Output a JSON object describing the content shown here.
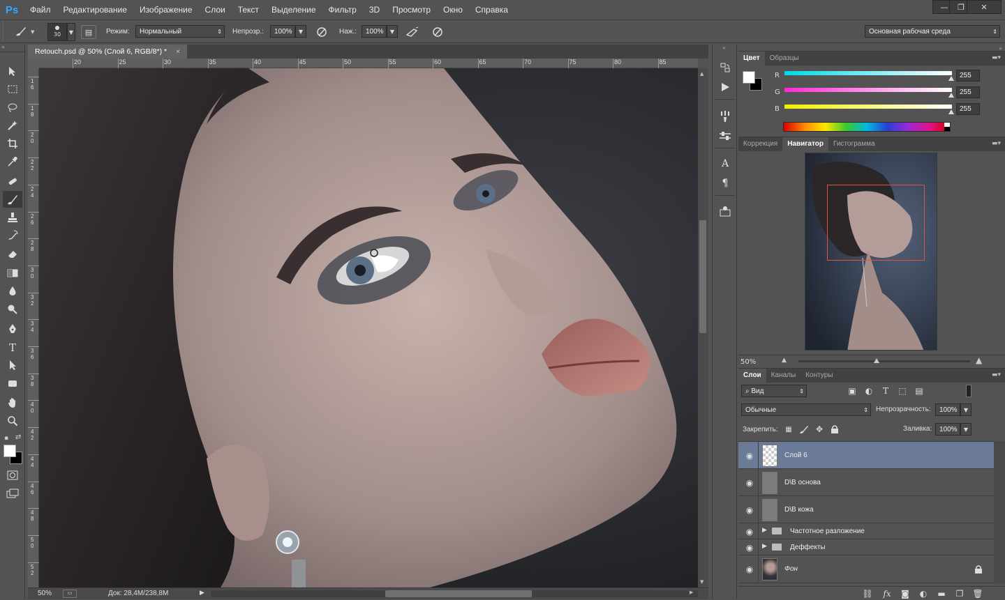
{
  "app": {
    "logo": "Ps"
  },
  "menu": [
    "Файл",
    "Редактирование",
    "Изображение",
    "Слои",
    "Текст",
    "Выделение",
    "Фильтр",
    "3D",
    "Просмотр",
    "Окно",
    "Справка"
  ],
  "window_controls": {
    "minimize": "—",
    "restore": "❐",
    "close": "✕"
  },
  "options": {
    "brush_size": "30",
    "mode_label": "Режим:",
    "mode_value": "Нормальный",
    "opacity_label": "Непрозр.:",
    "opacity_value": "100%",
    "flow_label": "Наж.:",
    "flow_value": "100%",
    "workspace": "Основная рабочая среда"
  },
  "document": {
    "tab_title": "Retouch.psd @ 50% (Слой 6, RGB/8*) *",
    "close": "×",
    "ruler_h": [
      "20",
      "25",
      "30",
      "35",
      "40",
      "45",
      "50",
      "55",
      "60",
      "65",
      "70",
      "75",
      "80",
      "85"
    ],
    "ruler_v": [
      "16",
      "18",
      "20",
      "22",
      "24",
      "26",
      "28",
      "30",
      "32",
      "34",
      "36",
      "38",
      "40",
      "42",
      "44",
      "46",
      "48",
      "50",
      "52"
    ],
    "zoom": "50%",
    "doc_info": "Док: 28,4M/238,8M"
  },
  "color_panel": {
    "tabs": [
      "Цвет",
      "Образцы"
    ],
    "channels": [
      {
        "label": "R",
        "value": "255",
        "gradient": "#00d8e8"
      },
      {
        "label": "G",
        "value": "255",
        "gradient": "#ff2ad4"
      },
      {
        "label": "B",
        "value": "255",
        "gradient": "#f0f000"
      }
    ]
  },
  "navigator_panel": {
    "tabs": [
      "Коррекция",
      "Навигатор",
      "Гистограмма"
    ],
    "zoom": "50%",
    "view_box_color": "#e0533c"
  },
  "layers_panel": {
    "tabs": [
      "Слои",
      "Каналы",
      "Контуры"
    ],
    "filter_label": "Вид",
    "blend_mode": "Обычные",
    "opacity_label": "Непрозрачность:",
    "opacity_value": "100%",
    "lock_label": "Закрепить:",
    "fill_label": "Заливка:",
    "fill_value": "100%",
    "layers": [
      {
        "name": "Слой 6",
        "type": "transparent",
        "selected": true
      },
      {
        "name": "D\\B основа",
        "type": "gray",
        "selected": false
      },
      {
        "name": "D\\B кожа",
        "type": "gray",
        "selected": false
      },
      {
        "name": "Частотное разложение",
        "type": "group",
        "selected": false
      },
      {
        "name": "Деффекты",
        "type": "group",
        "selected": false
      },
      {
        "name": "Фон",
        "type": "photo",
        "selected": false,
        "locked": true
      }
    ]
  },
  "icons": {
    "tools": [
      "move-icon",
      "marquee-icon",
      "lasso-icon",
      "magic-wand-icon",
      "crop-icon",
      "eyedropper-icon",
      "healing-brush-icon",
      "brush-icon",
      "clone-stamp-icon",
      "history-brush-icon",
      "eraser-icon",
      "gradient-icon",
      "blur-icon",
      "dodge-icon",
      "pen-icon",
      "type-icon",
      "path-selection-icon",
      "shape-icon",
      "hand-icon",
      "zoom-icon"
    ]
  }
}
